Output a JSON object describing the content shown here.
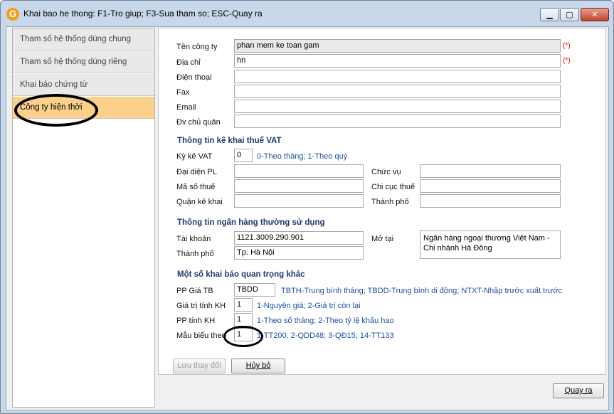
{
  "window": {
    "title": "Khai bao he thong: F1-Tro giup; F3-Sua tham so; ESC-Quay ra",
    "app_icon_letter": "G",
    "min_label": "▁",
    "max_label": "▢",
    "close_label": "✕"
  },
  "sidebar": {
    "items": [
      {
        "label": "Tham số hệ thống dùng chung"
      },
      {
        "label": "Tham số hệ thống dùng riêng"
      },
      {
        "label": "Khai báo chứng từ"
      },
      {
        "label": "Công ty hiện thời"
      }
    ],
    "active_index": 3
  },
  "company": {
    "ten_cong_ty": {
      "label": "Tên công ty",
      "value": "phan mem ke toan gam",
      "required": "(*)"
    },
    "dia_chi": {
      "label": "Địa chỉ",
      "value": "hn",
      "required": "(*)"
    },
    "dien_thoai": {
      "label": "Điện thoại",
      "value": ""
    },
    "fax": {
      "label": "Fax",
      "value": ""
    },
    "email": {
      "label": "Email",
      "value": ""
    },
    "dv_chu_quan": {
      "label": "Đv chủ quản",
      "value": ""
    }
  },
  "vat": {
    "section_title": "Thông tin kê khai thuế VAT",
    "ky_ke": {
      "label": "Kỳ kê VAT",
      "value": "0",
      "hint": "0-Theo tháng; 1-Theo quý"
    },
    "dai_dien": {
      "label": "Đại diện PL",
      "value": ""
    },
    "chuc_vu": {
      "label": "Chức vụ",
      "value": ""
    },
    "ma_so_thue": {
      "label": "Mã số thuế",
      "value": ""
    },
    "chi_cuc_thue": {
      "label": "Chi cục thuế",
      "value": ""
    },
    "quan_ke_khai": {
      "label": "Quận kê khai",
      "value": ""
    },
    "thanh_pho": {
      "label": "Thành phố",
      "value": ""
    }
  },
  "bank": {
    "section_title": "Thông tin ngân hàng thường sử dụng",
    "tai_khoan": {
      "label": "Tài khoản",
      "value": "1121.3009.290.901"
    },
    "mo_tai": {
      "label": "Mở tại",
      "value": "Ngân hàng ngoại thương Việt Nam - Chi nhánh Hà Đông"
    },
    "thanh_pho": {
      "label": "Thành phố",
      "value": "Tp. Hà Nội"
    }
  },
  "other": {
    "section_title": "Một số khai báo quan trọng khác",
    "pp_gia_tb": {
      "label": "PP Giá TB",
      "value": "TBDD",
      "hint": "TBTH-Trung bình tháng; TBDD-Trung bình di động; NTXT-Nhập trước xuất trước"
    },
    "gia_tri_tinh_kh": {
      "label": "Giá trị tính KH",
      "value": "1",
      "hint": "1-Nguyên giá; 2-Giá trị còn lại"
    },
    "pp_tinh_kh": {
      "label": "PP tính KH",
      "value": "1",
      "hint": "1-Theo số tháng; 2-Theo tỷ lệ khấu hao"
    },
    "mau_bieu_theo": {
      "label": "Mẫu biểu theo",
      "value": "1",
      "hint": "1-TT200; 2-QDD48; 3-QĐ15; 14-TT133"
    }
  },
  "buttons": {
    "save": "Lưu thay đổi",
    "cancel": "Hủy bỏ",
    "exit": "Quay ra"
  }
}
